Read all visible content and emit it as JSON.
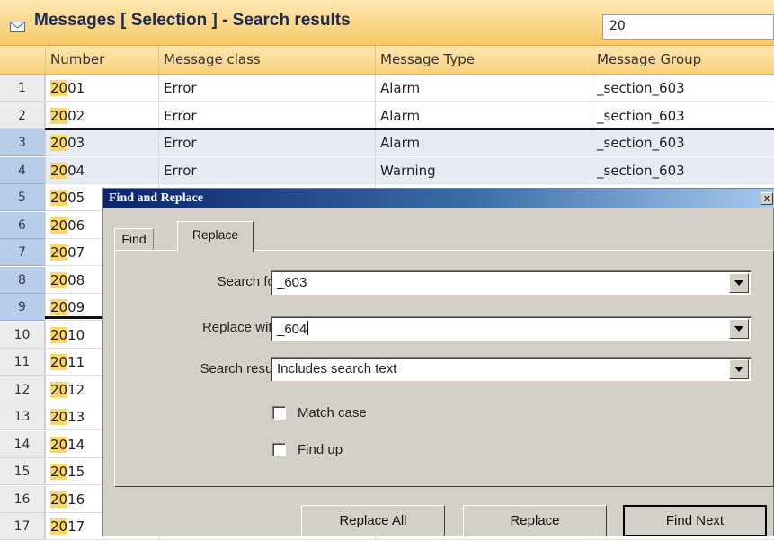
{
  "window": {
    "title": "Messages [ Selection ] - Search results",
    "result_count": "20"
  },
  "grid": {
    "columns": [
      "Number",
      "Message class",
      "Message Type",
      "Message Group"
    ],
    "rows": [
      {
        "n": "1",
        "prefix": "20",
        "suffix": "01",
        "cls": "Error",
        "type": "Alarm",
        "group": "_section_603"
      },
      {
        "n": "2",
        "prefix": "20",
        "suffix": "02",
        "cls": "Error",
        "type": "Alarm",
        "group": "_section_603"
      },
      {
        "n": "3",
        "prefix": "20",
        "suffix": "03",
        "cls": "Error",
        "type": "Alarm",
        "group": "_section_603"
      },
      {
        "n": "4",
        "prefix": "20",
        "suffix": "04",
        "cls": "Error",
        "type": "Warning",
        "group": "_section_603"
      },
      {
        "n": "5",
        "prefix": "20",
        "suffix": "05"
      },
      {
        "n": "6",
        "prefix": "20",
        "suffix": "06"
      },
      {
        "n": "7",
        "prefix": "20",
        "suffix": "07"
      },
      {
        "n": "8",
        "prefix": "20",
        "suffix": "08"
      },
      {
        "n": "9",
        "prefix": "20",
        "suffix": "09"
      },
      {
        "n": "10",
        "prefix": "20",
        "suffix": "10"
      },
      {
        "n": "11",
        "prefix": "20",
        "suffix": "11"
      },
      {
        "n": "12",
        "prefix": "20",
        "suffix": "12"
      },
      {
        "n": "13",
        "prefix": "20",
        "suffix": "13"
      },
      {
        "n": "14",
        "prefix": "20",
        "suffix": "14"
      },
      {
        "n": "15",
        "prefix": "20",
        "suffix": "15"
      },
      {
        "n": "16",
        "prefix": "20",
        "suffix": "16"
      },
      {
        "n": "17",
        "prefix": "20",
        "suffix": "17"
      }
    ]
  },
  "dialog": {
    "title": "Find and Replace",
    "close": "x",
    "tabs": [
      "Find",
      "Replace"
    ],
    "search_for_label": "Search for:",
    "search_for_value": "_603",
    "replace_with_label": "Replace with:",
    "replace_with_value": "_604",
    "search_result_label": "Search result:",
    "search_result_value": "Includes search text",
    "match_case": "Match case",
    "find_up": "Find up",
    "buttons": {
      "replace_all": "Replace All",
      "replace": "Replace",
      "find_next": "Find Next"
    }
  },
  "colors": {
    "highlight": "#fbd66b",
    "selection": "#b7cde8",
    "title_gradient_start": "#0a246a"
  }
}
